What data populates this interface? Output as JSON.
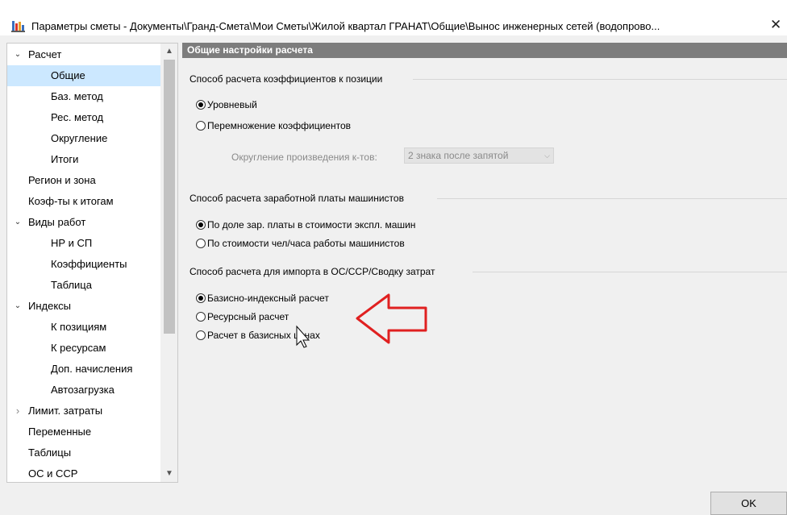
{
  "window": {
    "title": "Параметры сметы - Документы\\Гранд-Смета\\Мои Сметы\\Жилой квартал ГРАНАТ\\Общие\\Вынос инженерных сетей (водопрово...",
    "close_glyph": "✕"
  },
  "sidebar": {
    "items": [
      {
        "label": "Расчет",
        "chev": "⌄"
      },
      {
        "label": "Общие"
      },
      {
        "label": "Баз. метод"
      },
      {
        "label": "Рес. метод"
      },
      {
        "label": "Округление"
      },
      {
        "label": "Итоги"
      },
      {
        "label": "Регион и зона"
      },
      {
        "label": "Коэф-ты к итогам"
      },
      {
        "label": "Виды работ",
        "chev": "⌄"
      },
      {
        "label": "НР и СП"
      },
      {
        "label": "Коэффициенты"
      },
      {
        "label": "Таблица"
      },
      {
        "label": "Индексы",
        "chev": "⌄"
      },
      {
        "label": "К позициям"
      },
      {
        "label": "К ресурсам"
      },
      {
        "label": "Доп. начисления"
      },
      {
        "label": "Автозагрузка"
      },
      {
        "label": "Лимит. затраты",
        "chev": "›"
      },
      {
        "label": "Переменные"
      },
      {
        "label": "Таблицы"
      },
      {
        "label": "ОС и ССР"
      }
    ]
  },
  "content": {
    "header": "Общие настройки расчета",
    "group1": {
      "title": "Способ расчета коэффициентов к позиции",
      "options": [
        "Уровневый",
        "Перемножение коэффициентов"
      ],
      "rounding_label": "Округление произведения к-тов:",
      "rounding_value": "2 знака после запятой"
    },
    "group2": {
      "title": "Способ расчета заработной платы машинистов",
      "options": [
        "По доле зар. платы в стоимости экспл. машин",
        "По стоимости чел/часа работы машинистов"
      ]
    },
    "group3": {
      "title": "Способ расчета для импорта в ОС/ССР/Сводку затрат",
      "options": [
        "Базисно-индексный расчет",
        "Ресурсный расчет",
        "Расчет в базисных ценах"
      ]
    }
  },
  "buttons": {
    "ok": "OK"
  },
  "colors": {
    "selected_bg": "#cce8ff",
    "header_bg": "#7d7d7d",
    "annotation_arrow": "#e02020"
  }
}
